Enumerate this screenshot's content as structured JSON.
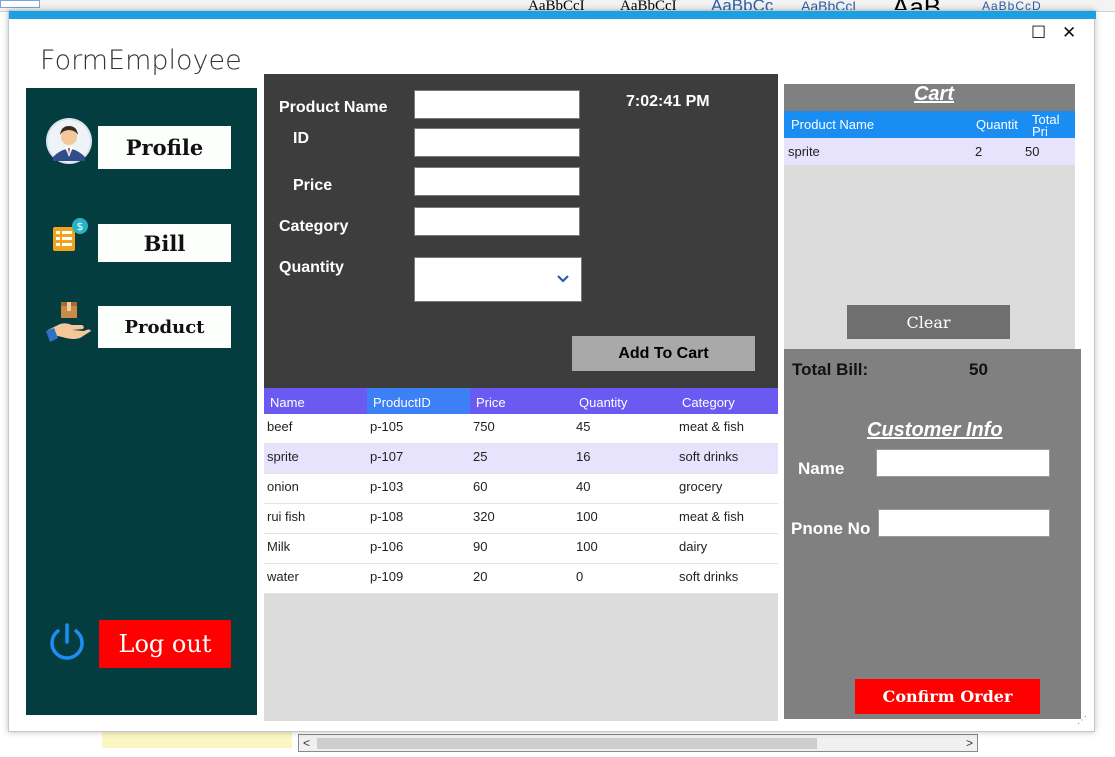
{
  "background_app": {
    "styles": [
      "AaBbCcI",
      "AaBbCcI",
      "AaBbCc",
      "AaBbCcL",
      "AaB",
      "AaBbCcD"
    ]
  },
  "window": {
    "title": "FormEmployee",
    "maximize_glyph": "☐",
    "close_glyph": "✕",
    "accent": "#1ba1e2"
  },
  "sidebar": {
    "profile": "Profile",
    "bill": "Bill",
    "product": "Product",
    "logout": "Log out",
    "bg": "#033d40"
  },
  "product_form": {
    "name_label": "Product Name",
    "id_label": "ID",
    "price_label": "Price",
    "category_label": "Category",
    "quantity_label": "Quantity",
    "time": "7:02:41 PM",
    "add_to_cart": "Add To Cart"
  },
  "product_table": {
    "columns": [
      "Name",
      "ProductID",
      "Price",
      "Quantity",
      "Category"
    ],
    "rows": [
      [
        "beef",
        "p-105",
        "750",
        "45",
        "meat & fish"
      ],
      [
        "sprite",
        "p-107",
        "25",
        "16",
        "soft drinks"
      ],
      [
        "onion",
        "p-103",
        "60",
        "40",
        "grocery"
      ],
      [
        "rui fish",
        "p-108",
        "320",
        "100",
        "meat & fish"
      ],
      [
        "Milk",
        "p-106",
        "90",
        "100",
        "dairy"
      ],
      [
        "water",
        "p-109",
        "20",
        "0",
        "soft drinks"
      ]
    ],
    "header_color": "#6a5af2",
    "selected_row_color": "#e7e3fd"
  },
  "cart": {
    "title": "Cart",
    "columns": [
      "Product Name",
      "Quantit",
      "Total Pri"
    ],
    "rows": [
      [
        "sprite",
        "2",
        "50"
      ]
    ],
    "clear": "Clear",
    "header_color": "#1a8df3"
  },
  "bill": {
    "total_label": "Total Bill:",
    "total_value": "50"
  },
  "customer": {
    "title": "Customer Info",
    "name_label": "Name",
    "phone_label": "Pnone No",
    "confirm": "Confirm Order"
  }
}
